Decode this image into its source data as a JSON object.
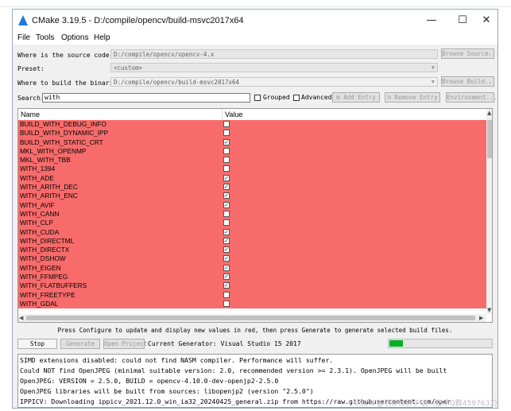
{
  "window": {
    "title": "CMake 3.19.5 - D:/compile/opencv/build-msvc2017x64",
    "minimize": "—",
    "maximize": "☐",
    "close": "✕"
  },
  "menu": [
    "File",
    "Tools",
    "Options",
    "Help"
  ],
  "source": {
    "label": "Where is the source code:",
    "value": "D:/compile/opencv/opencv-4.x",
    "button": "Browse Source..."
  },
  "preset": {
    "label": "Preset:",
    "value": "<custom>"
  },
  "build": {
    "label": "Where to build the binaries:",
    "value": "D:/compile/opencv/build-msvc2017x64",
    "button": "Browse Build..."
  },
  "search": {
    "label": "Search:",
    "value": "with",
    "grouped_label": "Grouped",
    "advanced_label": "Advanced",
    "add_entry": "Add Entry",
    "remove_entry": "Remove Entry",
    "environment": "Environment..."
  },
  "table": {
    "col_name": "Name",
    "col_value": "Value",
    "highlight_color": "#f86b6b",
    "rows": [
      {
        "name": "BUILD_WITH_DEBUG_INFO",
        "checked": false
      },
      {
        "name": "BUILD_WITH_DYNAMIC_IPP",
        "checked": false
      },
      {
        "name": "BUILD_WITH_STATIC_CRT",
        "checked": true
      },
      {
        "name": "MKL_WITH_OPENMP",
        "checked": false
      },
      {
        "name": "MKL_WITH_TBB",
        "checked": false
      },
      {
        "name": "WITH_1394",
        "checked": false
      },
      {
        "name": "WITH_ADE",
        "checked": true
      },
      {
        "name": "WITH_ARITH_DEC",
        "checked": true
      },
      {
        "name": "WITH_ARITH_ENC",
        "checked": true
      },
      {
        "name": "WITH_AVIF",
        "checked": true
      },
      {
        "name": "WITH_CANN",
        "checked": false
      },
      {
        "name": "WITH_CLP",
        "checked": false
      },
      {
        "name": "WITH_CUDA",
        "checked": true
      },
      {
        "name": "WITH_DIRECTML",
        "checked": true
      },
      {
        "name": "WITH_DIRECTX",
        "checked": true
      },
      {
        "name": "WITH_DSHOW",
        "checked": true
      },
      {
        "name": "WITH_EIGEN",
        "checked": true
      },
      {
        "name": "WITH_FFMPEG",
        "checked": true
      },
      {
        "name": "WITH_FLATBUFFERS",
        "checked": true
      },
      {
        "name": "WITH_FREETYPE",
        "checked": false
      },
      {
        "name": "WITH_GDAL",
        "checked": false
      }
    ]
  },
  "hint": "Press Configure to update and display new values in red, then press Generate to generate selected build files.",
  "actions": {
    "stop": "Stop",
    "generate": "Generate",
    "open_project": "Open Project",
    "current_generator": "Current Generator: Visual Studio 15 2017",
    "progress": 0.13,
    "progress_color": "#06b025"
  },
  "log": [
    "SIMD extensions disabled: could not find NASM compiler.  Performance will suffer.",
    "Could NOT find OpenJPEG (minimal suitable version: 2.0, recommended version >= 2.3.1). OpenJPEG will be built",
    "OpenJPEG: VERSION = 2.5.0, BUILD = opencv-4.10.0-dev-openjp2-2.5.0",
    "OpenJPEG libraries will be built from sources: libopenjp2 (version \"2.5.0\")",
    "IPPICV: Downloading ippicv_2021.12.0_win_ia32_20240425_general.zip from https://raw.githubusercontent.com/oper"
  ],
  "watermark": "CSDN @长沙红胖子Qt（技术Q群4597637）"
}
